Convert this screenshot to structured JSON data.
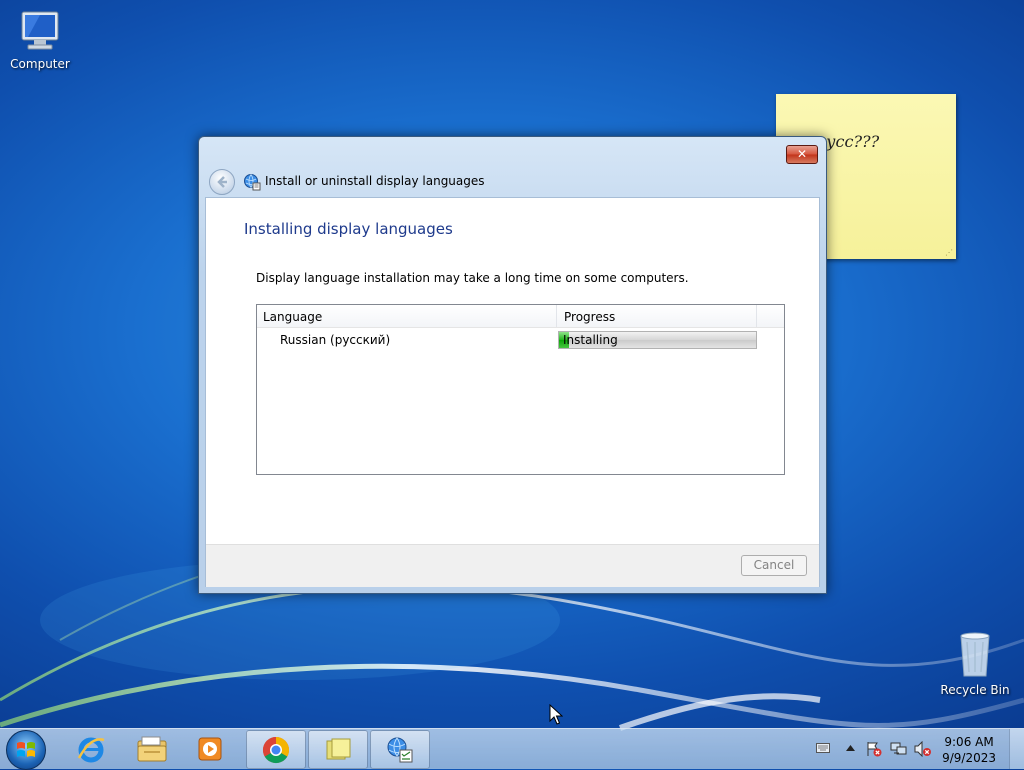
{
  "desktop": {
    "icons": [
      {
        "label": "Computer"
      },
      {
        "label": "Recycle Bin"
      }
    ]
  },
  "sticky_note": {
    "text": "русс???"
  },
  "window": {
    "title": "Install or uninstall display languages",
    "close_label": "✕",
    "heading": "Installing display languages",
    "description": "Display language installation may take a long time on some computers.",
    "table": {
      "columns": [
        "Language",
        "Progress"
      ],
      "rows": [
        {
          "language": "Russian (русский)",
          "status": "Installing",
          "progress": 0.05
        }
      ]
    },
    "cancel_label": "Cancel"
  },
  "taskbar": {
    "pinned": [
      "start-orb",
      "internet-explorer-icon",
      "file-explorer-icon",
      "media-player-icon",
      "chrome-icon",
      "sticky-notes-icon",
      "language-installer-icon"
    ],
    "clock": {
      "time": "9:06 AM",
      "date": "9/9/2023"
    }
  },
  "colors": {
    "accent": "#1e3a8c",
    "progress_fill": "#23b51d",
    "close_button": "#c2341b"
  }
}
